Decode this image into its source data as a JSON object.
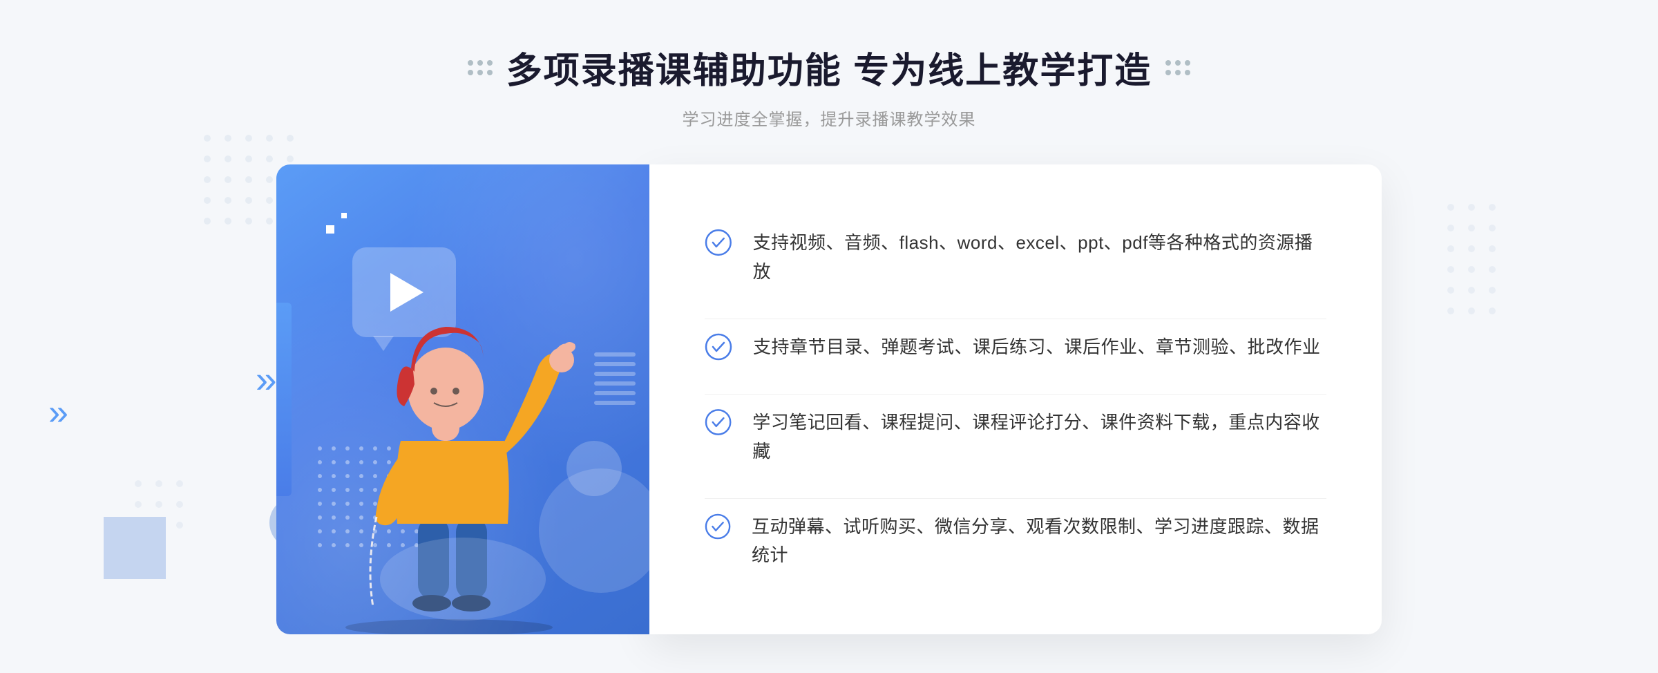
{
  "header": {
    "title": "多项录播课辅助功能 专为线上教学打造",
    "subtitle": "学习进度全掌握，提升录播课教学效果",
    "deco_label": "decoration-dots"
  },
  "features": [
    {
      "id": "feature-1",
      "text": "支持视频、音频、flash、word、excel、ppt、pdf等各种格式的资源播放",
      "icon": "check-circle-icon"
    },
    {
      "id": "feature-2",
      "text": "支持章节目录、弹题考试、课后练习、课后作业、章节测验、批改作业",
      "icon": "check-circle-icon"
    },
    {
      "id": "feature-3",
      "text": "学习笔记回看、课程提问、课程评论打分、课件资料下载，重点内容收藏",
      "icon": "check-circle-icon"
    },
    {
      "id": "feature-4",
      "text": "互动弹幕、试听购买、微信分享、观看次数限制、学习进度跟踪、数据统计",
      "icon": "check-circle-icon"
    }
  ],
  "colors": {
    "primary_blue": "#4a7de8",
    "light_blue": "#5b9cf6",
    "text_dark": "#1a1a2e",
    "text_gray": "#999999",
    "text_body": "#333333",
    "bg": "#f5f7fa",
    "white": "#ffffff"
  },
  "illustration": {
    "play_button_label": "play",
    "left_arrow": "«"
  }
}
